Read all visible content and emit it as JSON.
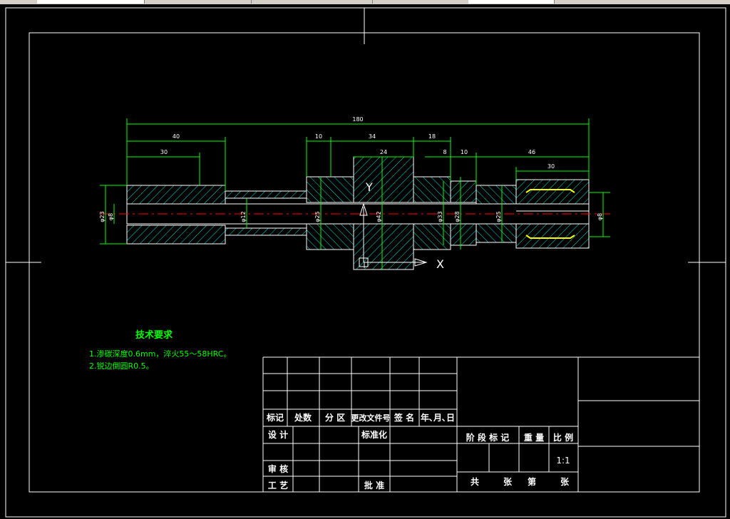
{
  "drawing": {
    "dims": {
      "overall": "180",
      "d40": "40",
      "d30a": "30",
      "d10a": "10",
      "d34": "34",
      "d24": "24",
      "d18": "18",
      "d8": "8",
      "d10b": "10",
      "d46": "46",
      "d30b": "30"
    },
    "diam": {
      "phi23": "φ23",
      "phi8a": "φ8",
      "phi12": "φ12",
      "phi25a": "φ25",
      "phi42": "φ42",
      "phi33": "φ33",
      "phi28": "φ28",
      "phi25b": "φ25",
      "phi8b": "φ8"
    },
    "axes": {
      "y": "Y",
      "x": "X"
    }
  },
  "tech": {
    "title": "技术要求",
    "line1": "1.渗碳深度0.6mm，淬火55～58HRC。",
    "line2": "2.锐边倒圆R0.5。"
  },
  "titleblock": {
    "biaoji": "标记",
    "chushu": "处数",
    "fenqu": "分 区",
    "genggai": "更改文件号",
    "qianming": "签 名",
    "nianyueri": "年､月､日",
    "sheji": "设 计",
    "biaozhunhua": "标准化",
    "jieduan": "阶 段 标 记",
    "zhongliang": "重 量",
    "bili": "比 例",
    "scale": "1:1",
    "shenhe": "审 核",
    "gongyi": "工 艺",
    "pizhun": "批 准",
    "gong": "共",
    "zhang1": "张",
    "di": "第",
    "zhang2": "张"
  },
  "colors": {
    "frame": "#ffffff",
    "dims": "#00ff00",
    "hatch": "#00e5e5",
    "center": "#ff0000",
    "thread": "#ffff00"
  }
}
